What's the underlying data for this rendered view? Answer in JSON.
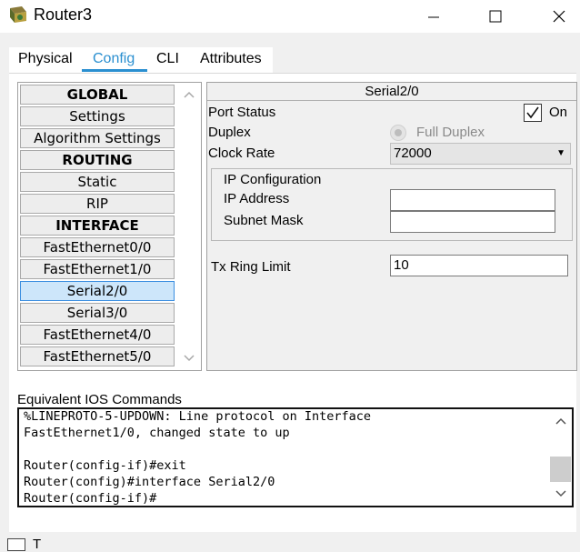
{
  "window": {
    "title": "Router3"
  },
  "tabs": [
    {
      "label": "Physical"
    },
    {
      "label": "Config"
    },
    {
      "label": "CLI"
    },
    {
      "label": "Attributes"
    }
  ],
  "sidebar": {
    "items": [
      {
        "label": "GLOBAL"
      },
      {
        "label": "Settings"
      },
      {
        "label": "Algorithm Settings"
      },
      {
        "label": "ROUTING"
      },
      {
        "label": "Static"
      },
      {
        "label": "RIP"
      },
      {
        "label": "INTERFACE"
      },
      {
        "label": "FastEthernet0/0"
      },
      {
        "label": "FastEthernet1/0"
      },
      {
        "label": "Serial2/0"
      },
      {
        "label": "Serial3/0"
      },
      {
        "label": "FastEthernet4/0"
      },
      {
        "label": "FastEthernet5/0"
      }
    ],
    "selected": "Serial2/0"
  },
  "panel": {
    "title": "Serial2/0",
    "port_status_label": "Port Status",
    "port_status_checked": true,
    "port_status_value": "On",
    "duplex_label": "Duplex",
    "duplex_value": "Full Duplex",
    "clock_rate_label": "Clock Rate",
    "clock_rate_value": "72000",
    "ip_config_title": "IP Configuration",
    "ip_address_label": "IP Address",
    "ip_address_value": "",
    "subnet_mask_label": "Subnet Mask",
    "subnet_mask_value": "",
    "tx_ring_label": "Tx Ring Limit",
    "tx_ring_value": "10"
  },
  "console": {
    "label": "Equivalent IOS Commands",
    "lines": [
      "%LINEPROTO-5-UPDOWN: Line protocol on Interface",
      "FastEthernet1/0, changed state to up",
      "",
      "Router(config-if)#exit",
      "Router(config)#interface Serial2/0",
      "Router(config-if)#"
    ]
  },
  "footer": {
    "text": "T"
  }
}
